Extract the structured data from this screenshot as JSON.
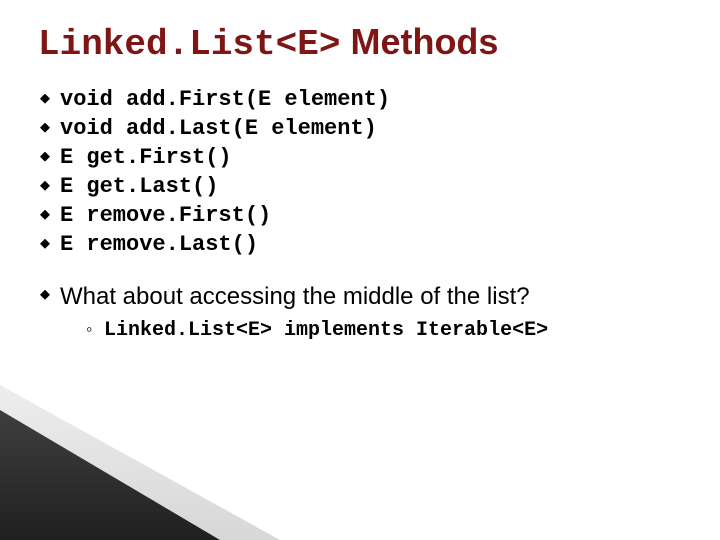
{
  "title": {
    "code": "Linked.List<E>",
    "rest": " Methods"
  },
  "methods": [
    "void add.First(E element)",
    "void add.Last(E element)",
    "E get.First()",
    "E get.Last()",
    "E remove.First()",
    "E remove.Last()"
  ],
  "question": "What about accessing the middle of the list?",
  "answer": "Linked.List<E> implements Iterable<E>"
}
